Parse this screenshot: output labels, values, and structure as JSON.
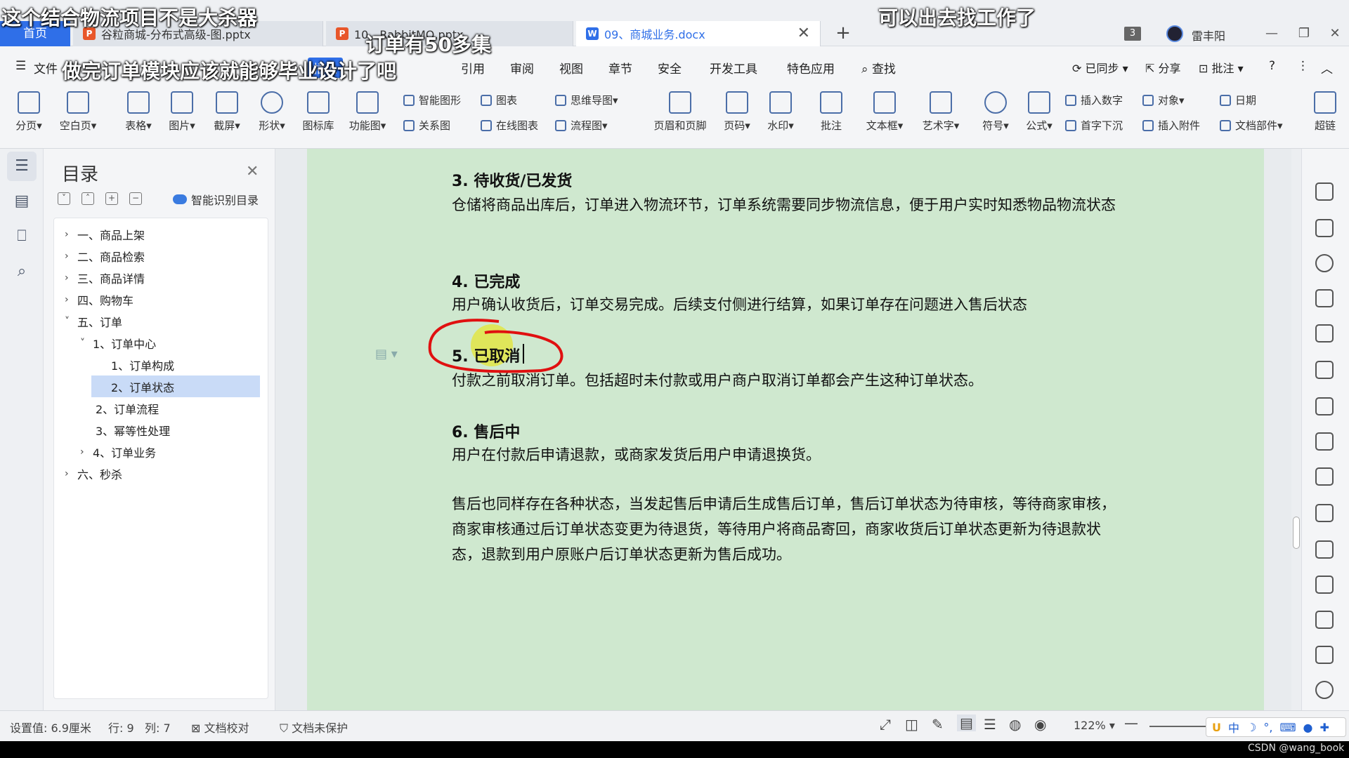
{
  "overlay": {
    "top_left": "这个结合物流项目不是大杀器",
    "top_right": "可以出去找工作了",
    "mid_top": "订单有50多集",
    "menu_line": "做完订单模块应该就能够毕业设计了吧"
  },
  "tabs": {
    "home": "首页",
    "tab1": "谷粒商城-分布式高级-图.pptx",
    "tab2": "10、RabbitMQ.pptx",
    "tab3": "09、商城业务.docx",
    "count": "3",
    "user": "雷丰阳"
  },
  "menu": {
    "file": "文件",
    "insert": "插入",
    "reference": "引用",
    "review": "审阅",
    "view": "视图",
    "chapter": "章节",
    "security": "安全",
    "devtools": "开发工具",
    "features": "特色应用",
    "search": "查找",
    "synced": "已同步",
    "share": "分享",
    "annotate": "批注"
  },
  "ribbon": {
    "page_break": "分页",
    "blank_page": "空白页",
    "table": "表格",
    "picture": "图片",
    "screenshot": "截屏",
    "shape": "形状",
    "icon_lib": "图标库",
    "func_chart": "功能图",
    "smart_shape": "智能图形",
    "chart": "图表",
    "mindmap": "思维导图",
    "relation": "关系图",
    "online_chart": "在线图表",
    "flowchart": "流程图",
    "header_footer": "页眉和页脚",
    "page_num": "页码",
    "watermark": "水印",
    "comment": "批注",
    "textbox": "文本框",
    "wordart": "艺术字",
    "symbol": "符号",
    "formula": "公式",
    "insert_number": "插入数字",
    "object": "对象",
    "date": "日期",
    "drop_cap": "首字下沉",
    "attachment": "插入附件",
    "doc_parts": "文档部件",
    "hyperlink": "超链"
  },
  "toc": {
    "title": "目录",
    "smart": "智能识别目录",
    "items": [
      {
        "label": "一、商品上架"
      },
      {
        "label": "二、商品检索"
      },
      {
        "label": "三、商品详情"
      },
      {
        "label": "四、购物车"
      },
      {
        "label": "五、订单"
      },
      {
        "label": "1、订单中心"
      },
      {
        "label": "1、订单构成"
      },
      {
        "label": "2、订单状态"
      },
      {
        "label": "2、订单流程"
      },
      {
        "label": "3、幂等性处理"
      },
      {
        "label": "4、订单业务"
      },
      {
        "label": "六、秒杀"
      }
    ]
  },
  "doc": {
    "h3": "3. 待收货/已发货",
    "p3": "仓储将商品出库后，订单进入物流环节，订单系统需要同步物流信息，便于用户实时知悉物品物流状态",
    "h4": "4. 已完成",
    "p4": "用户确认收货后，订单交易完成。后续支付侧进行结算，如果订单存在问题进入售后状态",
    "h5": "5. 已取消",
    "p5": "付款之前取消订单。包括超时未付款或用户商户取消订单都会产生这种订单状态。",
    "h6": "6. 售后中",
    "p6": "用户在付款后申请退款，或商家发货后用户申请退换货。",
    "p7": "售后也同样存在各种状态，当发起售后申请后生成售后订单，售后订单状态为待审核，等待商家审核，商家审核通过后订单状态变更为待退货，等待用户将商品寄回，商家收货后订单状态更新为待退款状态，退款到用户原账户后订单状态更新为售后成功。"
  },
  "status": {
    "setting": "设置值: 6.9厘米",
    "row": "行: 9",
    "col": "列: 7",
    "proof": "文档校对",
    "protect": "文档未保护",
    "zoom": "122%",
    "watermark": "CSDN @wang_book"
  },
  "ime": {
    "lang": "中"
  }
}
